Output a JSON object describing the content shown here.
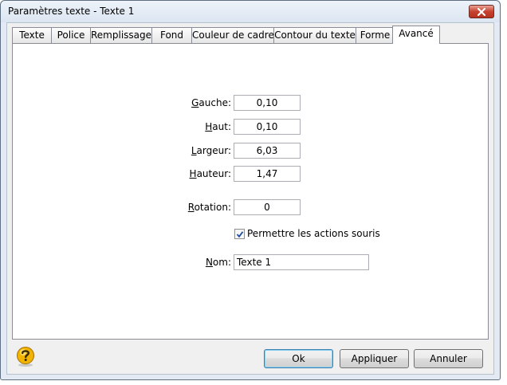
{
  "window": {
    "title": "Paramètres texte - Texte 1"
  },
  "tabs": [
    {
      "label": "Texte"
    },
    {
      "label": "Police"
    },
    {
      "label": "Remplissage"
    },
    {
      "label": "Fond"
    },
    {
      "label": "Couleur de cadre"
    },
    {
      "label": "Contour du texte"
    },
    {
      "label": "Forme"
    },
    {
      "label": "Avancé",
      "active": true
    }
  ],
  "fields": {
    "gauche": {
      "label_first": "G",
      "label_rest": "auche:",
      "value": "0,10"
    },
    "haut": {
      "label_first": "H",
      "label_rest": "aut:",
      "value": "0,10"
    },
    "largeur": {
      "label_first": "L",
      "label_rest": "argeur:",
      "value": "6,03"
    },
    "hauteur": {
      "label_first": "H",
      "label_rest": "auteur:",
      "value": "1,47"
    },
    "rotation": {
      "label_first": "R",
      "label_rest": "otation:",
      "value": "0"
    },
    "nom": {
      "label_first": "N",
      "label_rest": "om:",
      "value": "Texte 1"
    }
  },
  "mouse_actions": {
    "label": "Permettre les actions souris",
    "checked": true
  },
  "buttons": {
    "ok": "Ok",
    "apply": "Appliquer",
    "cancel": "Annuler"
  },
  "icons": {
    "close": "close-icon",
    "help": "help-icon",
    "check": "checkmark-icon"
  },
  "colors": {
    "close_button": "#c7412f",
    "help_icon": "#f2b400",
    "check": "#1f4e9c"
  }
}
